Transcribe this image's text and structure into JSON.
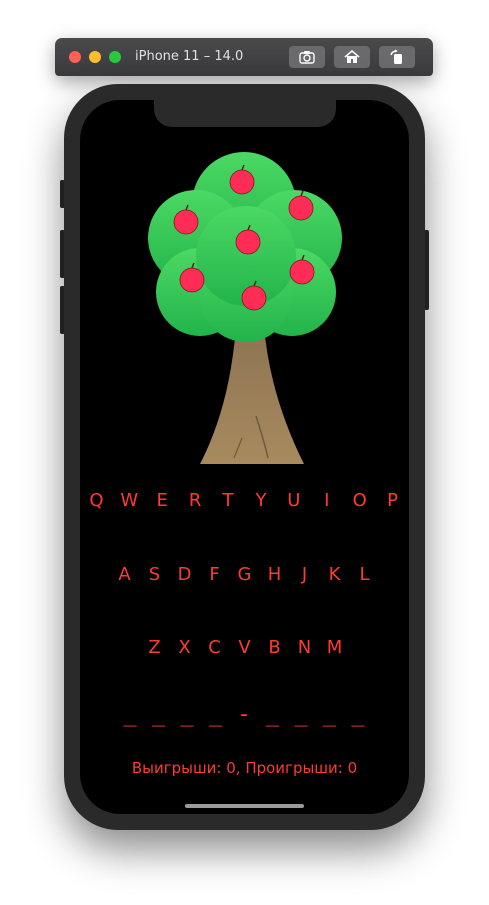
{
  "window": {
    "title": "iPhone 11 – 14.0"
  },
  "toolbar": {
    "screenshot_icon": "camera-icon",
    "home_icon": "home-icon",
    "rotate_icon": "rotate-icon"
  },
  "colors": {
    "accent": "#ff3b30",
    "screen_bg": "#000000",
    "tree_crown": "#34c759",
    "apple": "#ff2d55",
    "trunk": "#a88a5e"
  },
  "tree": {
    "apples_count": 7
  },
  "keyboard": {
    "row1": [
      "Q",
      "W",
      "E",
      "R",
      "T",
      "Y",
      "U",
      "I",
      "O",
      "P"
    ],
    "row2": [
      "A",
      "S",
      "D",
      "F",
      "G",
      "H",
      "J",
      "K",
      "L"
    ],
    "row3": [
      "Z",
      "X",
      "C",
      "V",
      "B",
      "N",
      "M"
    ]
  },
  "game": {
    "word_display": "_ _ _ _ - _ _ _ _",
    "score": "Выигрыши: 0, Проигрыши: 0"
  }
}
